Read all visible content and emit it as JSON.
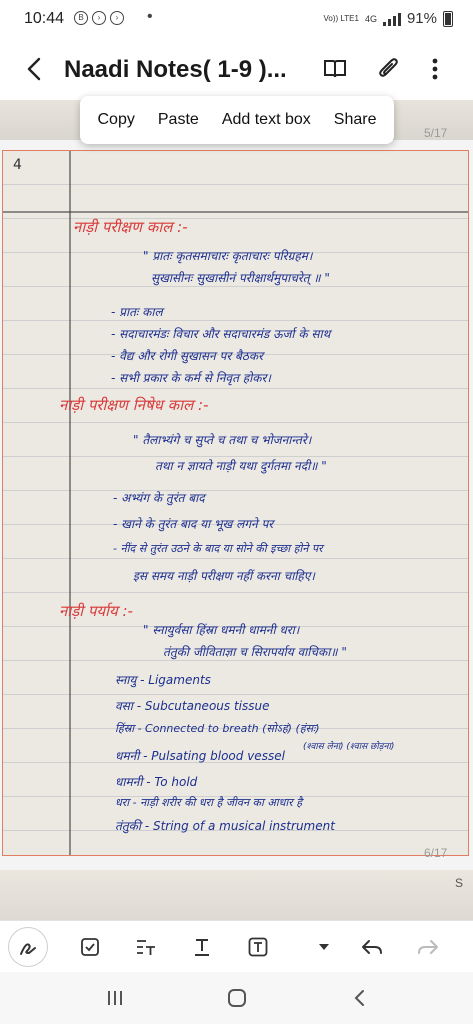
{
  "status_bar": {
    "time": "10:44",
    "notification_icons": [
      "notification-b-icon",
      "notification-circle-icon",
      "notification-circle-icon"
    ],
    "dot": "•",
    "volte": "Vo)) LTE1",
    "network": "4G",
    "battery": "91%"
  },
  "header": {
    "back_icon": "back-arrow-icon",
    "title": "Naadi Notes( 1-9 )...",
    "actions": [
      "book-icon",
      "paperclip-icon",
      "more-vert-icon"
    ]
  },
  "context_menu": {
    "items": [
      "Copy",
      "Paste",
      "Add text box",
      "Share"
    ]
  },
  "document": {
    "prev_page_number": "5/17",
    "current_page_number": "6/17",
    "note_page_number": "4",
    "next_page_marker": "S",
    "lines": [
      {
        "text": "नाड़ी परीक्षण काल :-",
        "color": "red"
      },
      {
        "text": "\" प्रातः कृतसमाचारः कृताचारः परिग्रहम।",
        "color": "blue"
      },
      {
        "text": "सुखासीनः सुखासीनं परीक्षार्थमुपाचरेत् ॥ \"",
        "color": "blue"
      },
      {
        "text": "- प्रातः काल",
        "color": "blue"
      },
      {
        "text": "- सदाचारमंडः विचार और सदाचारमंड ऊर्जा के साथ",
        "color": "blue"
      },
      {
        "text": "- वैद्य और रोगी सुखासन पर बैठकर",
        "color": "blue"
      },
      {
        "text": "- सभी प्रकार के कर्म से निवृत होकर।",
        "color": "blue"
      },
      {
        "text": "नाड़ी परीक्षण निषेध काल :-",
        "color": "red"
      },
      {
        "text": "\" तैलाभ्यंगे च सुप्ते च तथा च भोजनान्तरे।",
        "color": "blue"
      },
      {
        "text": "तथा न ज्ञायते नाड़ी यथा दुर्गतमा नदी॥ \"",
        "color": "blue"
      },
      {
        "text": "- अभ्यंग के तुरंत बाद",
        "color": "blue"
      },
      {
        "text": "- खाने के तुरंत बाद या भूख लगने पर",
        "color": "blue"
      },
      {
        "text": "- नींद से तुरंत उठने के बाद या सोने की इच्छा होने पर",
        "color": "blue"
      },
      {
        "text": "इस समय नाड़ी परीक्षण नहीं करना चाहिए।",
        "color": "blue"
      },
      {
        "text": "नाड़ी पर्याय :-",
        "color": "red"
      },
      {
        "text": "\" स्नायुर्वसा हिंस्रा धमनी धामनी धरा।",
        "color": "blue"
      },
      {
        "text": "तंतुकी जीविताज्ञा च सिरापर्याय वाचिका॥ \"",
        "color": "blue"
      },
      {
        "text": "स्नायु - Ligaments",
        "color": "blue"
      },
      {
        "text": "वसा - Subcutaneous tissue",
        "color": "blue"
      },
      {
        "text": "हिंस्रा - Connected to breath  (सोऽहं) (हंसः)",
        "color": "blue"
      },
      {
        "text": "(श्वास लेना) (श्वास छोड़ना)",
        "color": "blue"
      },
      {
        "text": "धमनी - Pulsating blood vessel",
        "color": "blue"
      },
      {
        "text": "धामनी - To hold",
        "color": "blue"
      },
      {
        "text": "धरा - नाड़ी शरीर की धरा है जीवन का आधार है",
        "color": "blue"
      },
      {
        "text": "तंतुकी - String of a musical instrument",
        "color": "blue"
      }
    ]
  },
  "toolbar": {
    "tools": [
      "pen-icon",
      "checkbox-icon",
      "text-format-icon",
      "text-underline-icon",
      "text-box-icon",
      "dropdown-arrow-icon",
      "undo-icon",
      "redo-icon"
    ]
  },
  "navbar": {
    "buttons": [
      "recents-icon",
      "home-icon",
      "back-icon"
    ]
  },
  "colors": {
    "ink_blue": "#1c2f8f",
    "ink_red": "#d93a3a",
    "page_border": "#e07d63"
  }
}
